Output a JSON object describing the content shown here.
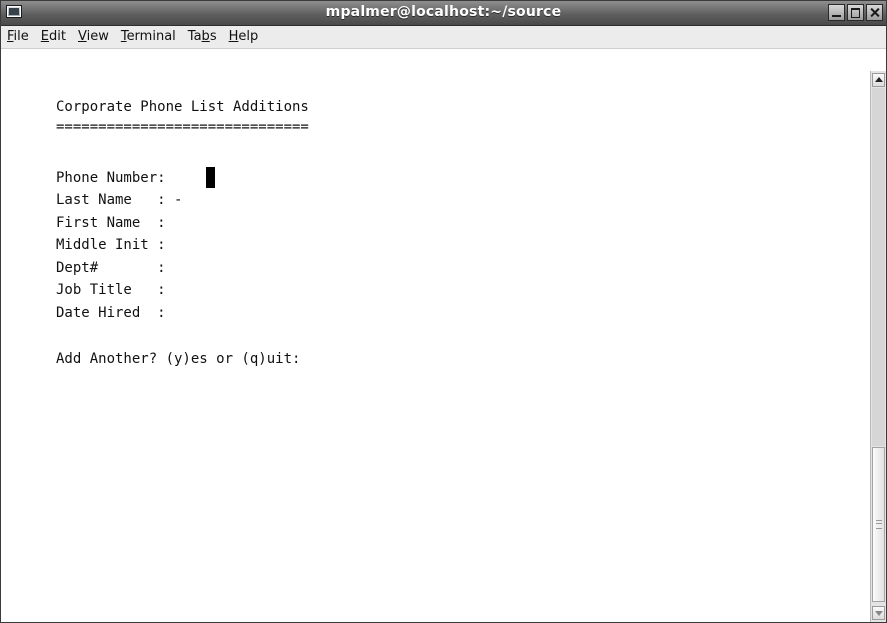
{
  "window": {
    "title": "mpalmer@localhost:~/source",
    "icon": "terminal-icon"
  },
  "menubar": {
    "items": [
      {
        "mnemonic": "F",
        "rest": "ile"
      },
      {
        "mnemonic": "E",
        "rest": "dit"
      },
      {
        "mnemonic": "V",
        "rest": "iew"
      },
      {
        "mnemonic": "T",
        "rest": "erminal"
      },
      {
        "pre": "Ta",
        "mnemonic": "b",
        "rest": "s"
      },
      {
        "mnemonic": "H",
        "rest": "elp"
      }
    ]
  },
  "terminal": {
    "heading": "Corporate Phone List Additions",
    "underline": "==============================",
    "fields": {
      "phone": "Phone Number:",
      "last": "Last Name   : -",
      "first": "First Name  :",
      "middle": "Middle Init :",
      "dept": "Dept#       :",
      "job": "Job Title   :",
      "hired": "Date Hired  :"
    },
    "prompt": "Add Another? (y)es or (q)uit:"
  }
}
